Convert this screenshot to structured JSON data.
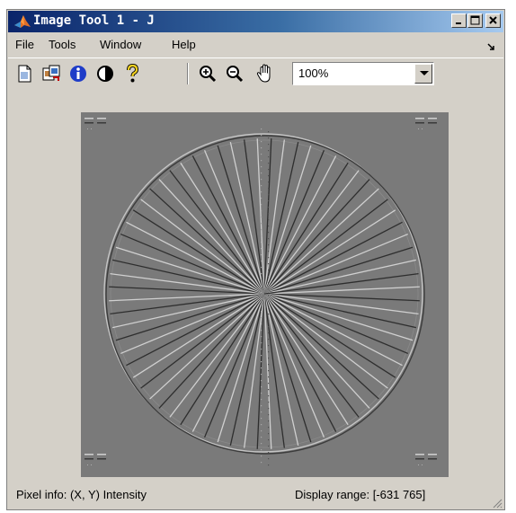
{
  "window": {
    "title": "Image Tool 1 - J"
  },
  "menu": {
    "items": [
      "File",
      "Tools",
      "Window",
      "Help"
    ]
  },
  "toolbar": {
    "tools": [
      "new-figure-icon",
      "export-image-icon",
      "image-info-icon",
      "adjust-contrast-icon",
      "help-icon",
      "zoom-in-icon",
      "zoom-out-icon",
      "pan-hand-icon"
    ],
    "zoom_value": "100%"
  },
  "status": {
    "pixel_info": "Pixel info: (X, Y)  Intensity",
    "display_range": "Display range: [-631 765]"
  },
  "image": {
    "description_icon": "starburst-test-pattern",
    "background": "#7a7a7a"
  }
}
